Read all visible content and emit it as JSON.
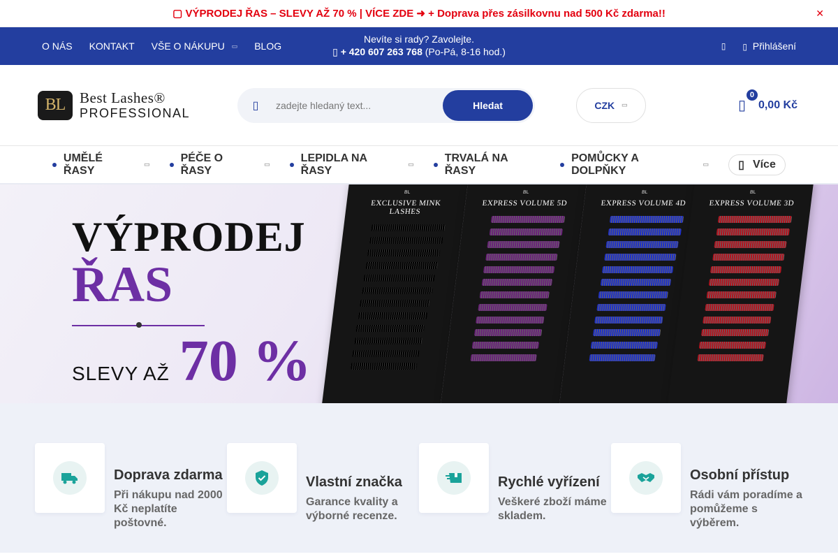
{
  "promo": {
    "text": "▢ VÝPRODEJ ŘAS – SLEVY AŽ 70 % | VÍCE ZDE ➜ + Doprava přes zásilkovnu nad 500 Kč zdarma!!",
    "close_icon": "close-icon"
  },
  "topnav": {
    "links": [
      {
        "label": "O NÁS"
      },
      {
        "label": "KONTAKT"
      },
      {
        "label": "VŠE O NÁKUPU",
        "has_dropdown": true
      },
      {
        "label": "BLOG"
      }
    ],
    "help_line": "Nevíte si rady? Zavolejte.",
    "phone": "+ 420 607 263 768",
    "hours": "(Po-Pá, 8-16 hod.)",
    "login_label": "Přihlášení"
  },
  "header": {
    "logo_initials": "BL",
    "logo_line1": "Best Lashes®",
    "logo_line2": "PROFESSIONAL",
    "search_placeholder": "zadejte hledaný text...",
    "search_button": "Hledat",
    "currency": "CZK",
    "cart_count": "0",
    "cart_total": "0,00 Kč"
  },
  "categories": [
    {
      "label": "UMĚLÉ ŘASY",
      "has_dropdown": true
    },
    {
      "label": "PÉČE O ŘASY",
      "has_dropdown": true
    },
    {
      "label": "LEPIDLA NA ŘASY",
      "has_dropdown": true
    },
    {
      "label": "TRVALÁ NA ŘASY",
      "has_dropdown": false
    },
    {
      "label": "POMŮCKY A DOLPŇKY",
      "has_dropdown": true
    }
  ],
  "more_label": "Více",
  "banner": {
    "line1": "VÝPRODEJ",
    "line2": "ŘAS",
    "sub_prefix": "SLEVY AŽ",
    "sub_value": "70 %",
    "trays": [
      {
        "title": "EXCLUSIVE MINK LASHES",
        "color": "#0d0d0d"
      },
      {
        "title": "EXPRESS VOLUME 5D",
        "color": "#6a1f7a"
      },
      {
        "title": "EXPRESS VOLUME 4D",
        "color": "#1d2fc9"
      },
      {
        "title": "EXPRESS VOLUME 3D",
        "color": "#b3121e"
      }
    ]
  },
  "features": [
    {
      "title": "Doprava zdarma",
      "desc": "Při nákupu nad 2000 Kč neplatíte poštovné.",
      "icon": "truck-icon"
    },
    {
      "title": "Vlastní značka",
      "desc": "Garance kvality a výborné recenze.",
      "icon": "shield-icon"
    },
    {
      "title": "Rychlé vyřízení",
      "desc": "Veškeré zboží máme skladem.",
      "icon": "box-icon"
    },
    {
      "title": "Osobní přístup",
      "desc": "Rádi vám poradíme a pomůžeme s výběrem.",
      "icon": "handshake-icon"
    }
  ],
  "colors": {
    "brand": "#233e9f",
    "promo": "#e3000f",
    "accent_purple": "#6d2fa4",
    "feature_icon": "#1aa39a"
  }
}
